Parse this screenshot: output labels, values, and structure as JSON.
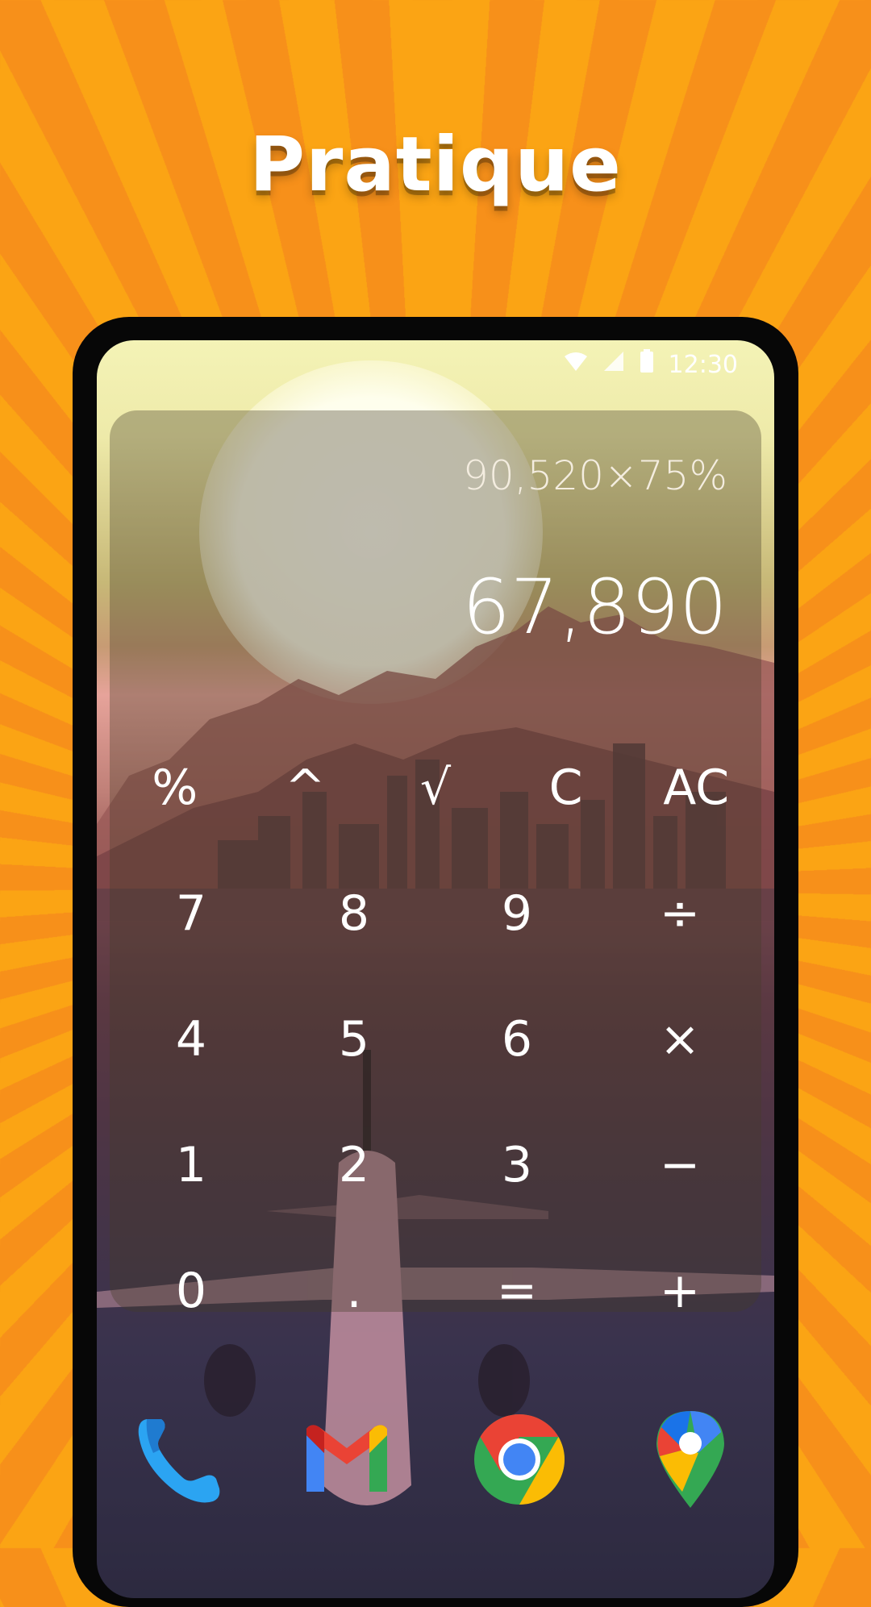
{
  "headline": "Pratique",
  "status_bar": {
    "time": "12:30",
    "icons": [
      "wifi-icon",
      "signal-icon",
      "battery-icon"
    ]
  },
  "calculator": {
    "expression": "90,520×75%",
    "result": "67,890",
    "keys": [
      [
        "%",
        "^",
        "√",
        "C",
        "AC"
      ],
      [
        "7",
        "8",
        "9",
        "÷"
      ],
      [
        "4",
        "5",
        "6",
        "×"
      ],
      [
        "1",
        "2",
        "3",
        "−"
      ],
      [
        "0",
        ".",
        "=",
        "+"
      ]
    ]
  },
  "dock": {
    "apps": [
      "phone-app-icon",
      "gmail-app-icon",
      "chrome-app-icon",
      "maps-app-icon"
    ]
  },
  "colors": {
    "background_stripe_light": "#fba414",
    "background_stripe_dark": "#f7901a",
    "phone_bezel": "#070707"
  }
}
